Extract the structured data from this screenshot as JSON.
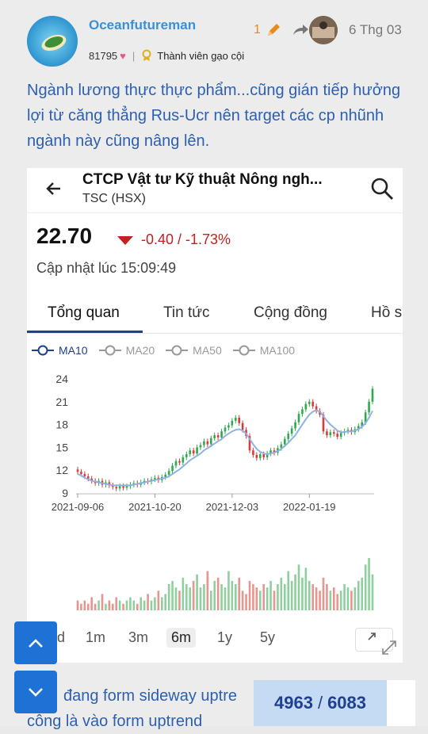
{
  "post": {
    "username": "Oceanfutureman",
    "points": "81795",
    "rank": "Thành viên gạo cội",
    "edit_count": "1",
    "date": "6 Thg 03",
    "text": "Ngành lương thực thực phẩm...cũng gián tiếp hưởng lợi từ căng thẳng Rus-Ucr nên target các cp nhũnh ngành này cũng nâng lên.",
    "below_text_1": "đang form sideway uptre",
    "below_text_2": "công là vào form uptrend"
  },
  "stock": {
    "title": "CTCP Vật tư Kỹ thuật Nông ngh...",
    "ticker": "TSC (HSX)",
    "price": "22.70",
    "change": "-0.40 / -1.73%",
    "updated": "Cập nhật lúc 15:09:49"
  },
  "tabs": [
    {
      "label": "Tổng quan"
    },
    {
      "label": "Tin tức"
    },
    {
      "label": "Cộng đồng"
    },
    {
      "label": "Hồ s"
    }
  ],
  "legend": [
    "MA10",
    "MA20",
    "MA50",
    "MA100"
  ],
  "ranges": [
    "d",
    "1m",
    "3m",
    "6m",
    "1y",
    "5y"
  ],
  "active_range": "6m",
  "counter": {
    "current": "4963",
    "total": "6083"
  },
  "colors": {
    "accent": "#1f3f8f",
    "up": "#2fa84f",
    "down": "#d93b3b",
    "ma": "#8fb3e0",
    "username": "#3b8fd6",
    "text_blue": "#2b5fb3"
  },
  "icons": {
    "back": "arrow-left-icon",
    "search": "search-icon",
    "expand": "expand-icon",
    "up": "chevron-up-icon",
    "down": "chevron-down-icon"
  },
  "chart_data": {
    "type": "candlestick",
    "y_ticks": [
      "24",
      "21",
      "18",
      "15",
      "12",
      "9"
    ],
    "x_ticks": [
      "2021-09-06",
      "2021-10-20",
      "2021-12-03",
      "2022-01-19"
    ],
    "ylim": [
      9,
      24
    ],
    "close": [
      11.8,
      11.5,
      11.2,
      10.9,
      10.6,
      10.3,
      10.6,
      10.1,
      10.4,
      10.0,
      9.8,
      9.6,
      9.9,
      9.7,
      9.9,
      10.1,
      10.3,
      10.1,
      10.4,
      10.6,
      10.5,
      10.8,
      11.0,
      10.7,
      11.1,
      11.4,
      11.9,
      12.6,
      13.2,
      13.0,
      13.7,
      14.1,
      14.6,
      14.2,
      15.0,
      15.3,
      15.8,
      15.4,
      16.2,
      16.6,
      16.3,
      17.1,
      17.6,
      17.9,
      18.5,
      18.9,
      18.2,
      17.3,
      16.5,
      14.6,
      14.0,
      13.6,
      14.1,
      13.7,
      14.2,
      14.6,
      14.3,
      14.9,
      15.4,
      16.1,
      16.8,
      17.5,
      18.3,
      19.4,
      20.0,
      20.7,
      21.0,
      20.4,
      19.8,
      19.3,
      17.1,
      16.6,
      17.0,
      16.8,
      16.4,
      16.9,
      17.1,
      17.3,
      17.0,
      17.4,
      17.8,
      18.3,
      19.6,
      21.0,
      22.7
    ],
    "ma10": [
      11.5,
      11.3,
      11.0,
      10.8,
      10.6,
      10.5,
      10.4,
      10.3,
      10.2,
      10.1,
      10.0,
      10.0,
      10.0,
      10.0,
      10.0,
      10.0,
      10.1,
      10.2,
      10.3,
      10.4,
      10.5,
      10.6,
      10.7,
      10.8,
      10.9,
      11.0,
      11.2,
      11.5,
      11.8,
      12.1,
      12.5,
      12.9,
      13.3,
      13.6,
      13.9,
      14.2,
      14.6,
      14.9,
      15.2,
      15.5,
      15.8,
      16.1,
      16.5,
      16.8,
      17.1,
      17.3,
      17.4,
      17.2,
      16.8,
      16.1,
      15.4,
      14.8,
      14.4,
      14.2,
      14.1,
      14.2,
      14.3,
      14.5,
      14.8,
      15.2,
      15.6,
      16.1,
      16.6,
      17.3,
      18.0,
      18.7,
      19.3,
      19.7,
      19.9,
      19.7,
      19.1,
      18.5,
      18.0,
      17.6,
      17.2,
      17.0,
      17.0,
      17.1,
      17.1,
      17.2,
      17.4,
      17.7,
      18.2,
      18.9,
      19.8
    ],
    "volumes": [
      3,
      2,
      3,
      2,
      4,
      2,
      3,
      5,
      2,
      3,
      2,
      4,
      3,
      2,
      3,
      4,
      3,
      2,
      4,
      3,
      5,
      3,
      4,
      6,
      4,
      5,
      8,
      9,
      7,
      6,
      10,
      8,
      7,
      9,
      11,
      7,
      8,
      12,
      6,
      9,
      10,
      8,
      7,
      12,
      9,
      8,
      10,
      6,
      5,
      9,
      8,
      7,
      6,
      8,
      7,
      9,
      6,
      8,
      10,
      8,
      12,
      9,
      11,
      14,
      10,
      13,
      9,
      8,
      7,
      6,
      10,
      8,
      6,
      7,
      5,
      6,
      8,
      7,
      6,
      7,
      9,
      10,
      14,
      16,
      11
    ],
    "volume_unit": "relative"
  }
}
